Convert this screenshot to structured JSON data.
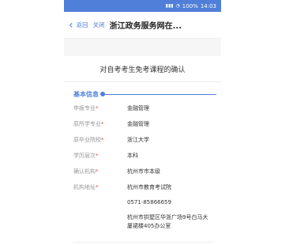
{
  "status_bar": {
    "icons": [
      "signal-icon",
      "wifi-icon"
    ],
    "battery_text": "100%",
    "time": "14:03"
  },
  "nav": {
    "back_label": "返回",
    "close_label": "关闭",
    "title": "浙江政务服务网在..."
  },
  "page": {
    "card_title": "对自考考生免考课程的确认",
    "section_title": "基本信息",
    "rows": [
      {
        "label": "申报专业",
        "required": "*",
        "value": "金融管理"
      },
      {
        "label": "原所学专业",
        "required": "*",
        "value": "金融管理"
      },
      {
        "label": "原毕业院校",
        "required": "*",
        "value": "浙江大学"
      },
      {
        "label": "学历层次",
        "required": "*",
        "value": "本科"
      },
      {
        "label": "确认机构",
        "required": "*",
        "value": "杭州市市本级"
      },
      {
        "label": "机构地址",
        "required": "*",
        "value_lines": [
          "杭州市教育考试院",
          "0571-85866659",
          "杭州市拱墅区华浙广场9号白马大厦裙楼405办公室"
        ]
      }
    ]
  },
  "colors": {
    "accent": "#4f7fd8",
    "required": "#d9534f"
  }
}
